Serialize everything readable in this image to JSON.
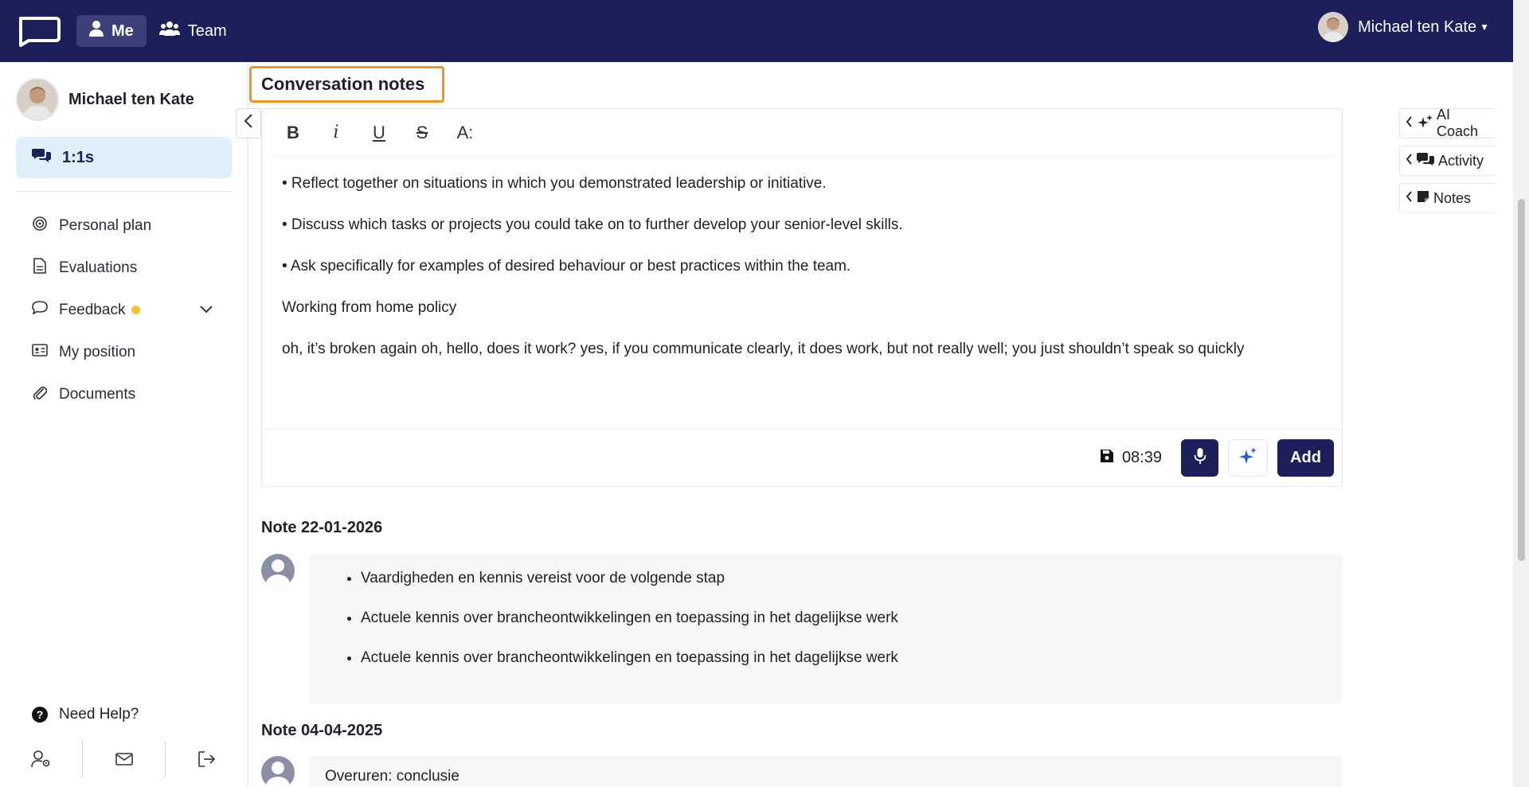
{
  "topbar": {
    "me_label": "Me",
    "team_label": "Team",
    "user_name": "Michael ten Kate"
  },
  "sidebar": {
    "profile_name": "Michael ten Kate",
    "active_item": "1:1s",
    "items": [
      {
        "label": "Personal plan"
      },
      {
        "label": "Evaluations"
      },
      {
        "label": "Feedback"
      },
      {
        "label": "My position"
      },
      {
        "label": "Documents"
      }
    ],
    "help_label": "Need Help?"
  },
  "main": {
    "section_title": "Conversation notes",
    "editor": {
      "toolbar": [
        "B",
        "i",
        "U",
        "S",
        "A:"
      ],
      "paragraphs": [
        "• Reflect together on situations  in which you demonstrated leadership or initiative.",
        "• Discuss  which tasks or projects you  could take on to further develop your senior-level skills.",
        "• Ask specifically for examples  of desired behaviour or best  practices within the team.",
        "Working from home policy",
        "oh, it’s broken again oh, hello, does it work? yes, if you communicate clearly, it does work, but not really well; you just shouldn’t speak so quickly"
      ],
      "save_time": "08:39",
      "add_label": "Add"
    },
    "notes": [
      {
        "title": "Note 22-01-2026",
        "items": [
          "Vaardigheden en kennis vereist voor de volgende stap",
          "Actuele kennis over brancheontwikkelingen en toepassing in het dagelijkse werk",
          "Actuele kennis over brancheontwikkelingen en toepassing in het dagelijkse werk"
        ]
      },
      {
        "title": "Note 04-04-2025",
        "text": "Overuren: conclusie"
      }
    ]
  },
  "right_panel": {
    "tabs": [
      "AI Coach",
      "Activity",
      "Notes"
    ]
  },
  "colors": {
    "navy": "#1c1f5a",
    "accent_orange": "#f0942a",
    "active_bg": "#dff0fb",
    "badge_yellow": "#f2c233"
  },
  "icons": [
    "logo-icon",
    "user-icon",
    "team-icon",
    "caret-down-icon",
    "comments-icon",
    "target-icon",
    "document-icon",
    "chat-icon",
    "id-card-icon",
    "paperclip-icon",
    "question-icon",
    "user-gear-icon",
    "envelope-icon",
    "logout-icon",
    "save-icon",
    "microphone-icon",
    "sparkles-icon",
    "sticky-note-icon",
    "chevron-left-icon"
  ]
}
